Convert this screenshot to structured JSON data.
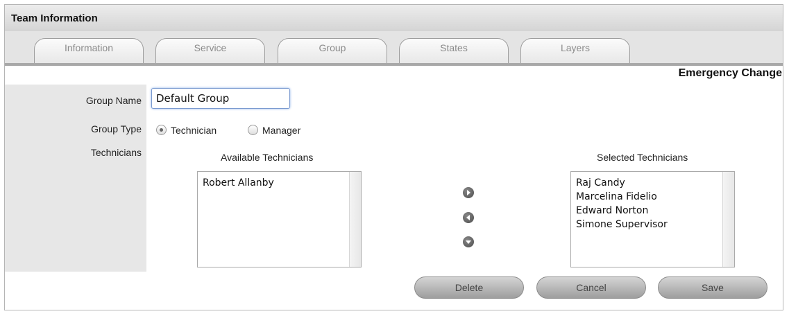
{
  "panel": {
    "title": "Team Information"
  },
  "tabs": [
    {
      "label": "Information"
    },
    {
      "label": "Service"
    },
    {
      "label": "Group"
    },
    {
      "label": "States"
    },
    {
      "label": "Layers"
    }
  ],
  "mode_label": "Emergency Change",
  "form": {
    "group_name_label": "Group Name",
    "group_name_value": "Default Group",
    "group_type_label": "Group Type",
    "group_type_options": [
      {
        "label": "Technician",
        "checked": true
      },
      {
        "label": "Manager",
        "checked": false
      }
    ],
    "technicians_label": "Technicians"
  },
  "available": {
    "heading": "Available Technicians",
    "items": [
      "Robert Allanby"
    ]
  },
  "selected": {
    "heading": "Selected Technicians",
    "items": [
      "Raj Candy",
      "Marcelina Fidelio",
      "Edward Norton",
      "Simone Supervisor"
    ]
  },
  "move_controls": [
    {
      "icon": "arrow-right-icon"
    },
    {
      "icon": "arrow-left-icon"
    },
    {
      "icon": "arrow-down-icon"
    }
  ],
  "buttons": {
    "delete": "Delete",
    "cancel": "Cancel",
    "save": "Save"
  }
}
